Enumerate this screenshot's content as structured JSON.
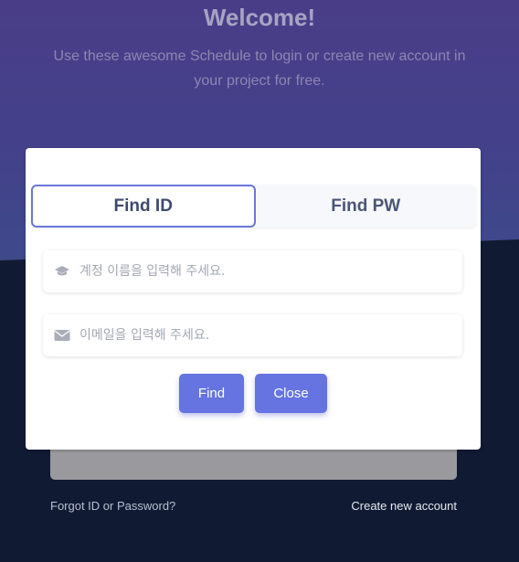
{
  "hero": {
    "title": "Welcome!",
    "subtitle": "Use these awesome Schedule to login or create new account in your project for free."
  },
  "footer": {
    "forgot_link": "Forgot ID or Password?",
    "create_link": "Create new account"
  },
  "modal": {
    "tabs": [
      {
        "label": "Find ID",
        "active": true
      },
      {
        "label": "Find PW",
        "active": false
      }
    ],
    "fields": {
      "account_name": {
        "placeholder": "계정 이름을 입력해 주세요.",
        "value": "",
        "icon": "graduation-cap-icon"
      },
      "email": {
        "placeholder": "이메일을 입력해 주세요.",
        "value": "",
        "icon": "envelope-icon"
      }
    },
    "buttons": {
      "find": "Find",
      "close": "Close"
    }
  },
  "colors": {
    "accent": "#6574e0",
    "hero_bg": "#4a3d88",
    "page_bg": "#101b33"
  }
}
